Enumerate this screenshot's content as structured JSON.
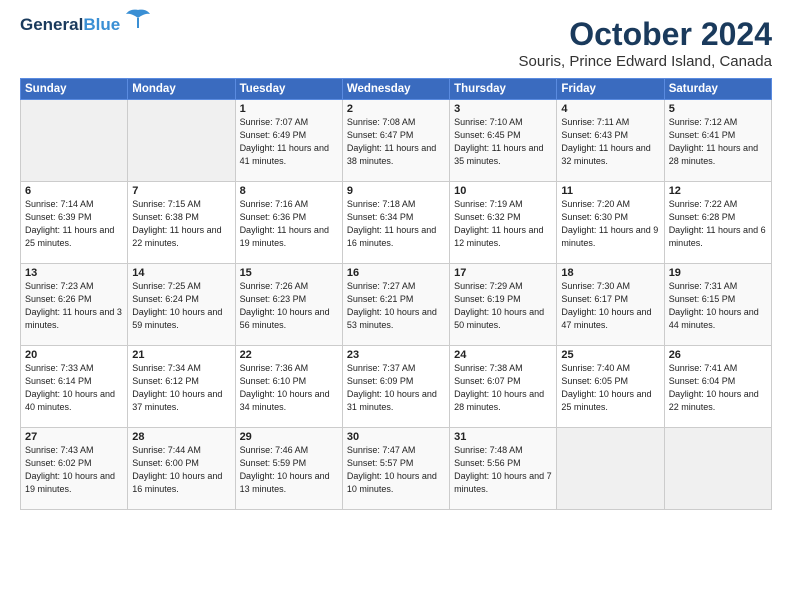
{
  "logo": {
    "line1": "General",
    "line2": "Blue"
  },
  "title": "October 2024",
  "subtitle": "Souris, Prince Edward Island, Canada",
  "weekdays": [
    "Sunday",
    "Monday",
    "Tuesday",
    "Wednesday",
    "Thursday",
    "Friday",
    "Saturday"
  ],
  "weeks": [
    [
      {
        "day": "",
        "sunrise": "",
        "sunset": "",
        "daylight": ""
      },
      {
        "day": "",
        "sunrise": "",
        "sunset": "",
        "daylight": ""
      },
      {
        "day": "1",
        "sunrise": "Sunrise: 7:07 AM",
        "sunset": "Sunset: 6:49 PM",
        "daylight": "Daylight: 11 hours and 41 minutes."
      },
      {
        "day": "2",
        "sunrise": "Sunrise: 7:08 AM",
        "sunset": "Sunset: 6:47 PM",
        "daylight": "Daylight: 11 hours and 38 minutes."
      },
      {
        "day": "3",
        "sunrise": "Sunrise: 7:10 AM",
        "sunset": "Sunset: 6:45 PM",
        "daylight": "Daylight: 11 hours and 35 minutes."
      },
      {
        "day": "4",
        "sunrise": "Sunrise: 7:11 AM",
        "sunset": "Sunset: 6:43 PM",
        "daylight": "Daylight: 11 hours and 32 minutes."
      },
      {
        "day": "5",
        "sunrise": "Sunrise: 7:12 AM",
        "sunset": "Sunset: 6:41 PM",
        "daylight": "Daylight: 11 hours and 28 minutes."
      }
    ],
    [
      {
        "day": "6",
        "sunrise": "Sunrise: 7:14 AM",
        "sunset": "Sunset: 6:39 PM",
        "daylight": "Daylight: 11 hours and 25 minutes."
      },
      {
        "day": "7",
        "sunrise": "Sunrise: 7:15 AM",
        "sunset": "Sunset: 6:38 PM",
        "daylight": "Daylight: 11 hours and 22 minutes."
      },
      {
        "day": "8",
        "sunrise": "Sunrise: 7:16 AM",
        "sunset": "Sunset: 6:36 PM",
        "daylight": "Daylight: 11 hours and 19 minutes."
      },
      {
        "day": "9",
        "sunrise": "Sunrise: 7:18 AM",
        "sunset": "Sunset: 6:34 PM",
        "daylight": "Daylight: 11 hours and 16 minutes."
      },
      {
        "day": "10",
        "sunrise": "Sunrise: 7:19 AM",
        "sunset": "Sunset: 6:32 PM",
        "daylight": "Daylight: 11 hours and 12 minutes."
      },
      {
        "day": "11",
        "sunrise": "Sunrise: 7:20 AM",
        "sunset": "Sunset: 6:30 PM",
        "daylight": "Daylight: 11 hours and 9 minutes."
      },
      {
        "day": "12",
        "sunrise": "Sunrise: 7:22 AM",
        "sunset": "Sunset: 6:28 PM",
        "daylight": "Daylight: 11 hours and 6 minutes."
      }
    ],
    [
      {
        "day": "13",
        "sunrise": "Sunrise: 7:23 AM",
        "sunset": "Sunset: 6:26 PM",
        "daylight": "Daylight: 11 hours and 3 minutes."
      },
      {
        "day": "14",
        "sunrise": "Sunrise: 7:25 AM",
        "sunset": "Sunset: 6:24 PM",
        "daylight": "Daylight: 10 hours and 59 minutes."
      },
      {
        "day": "15",
        "sunrise": "Sunrise: 7:26 AM",
        "sunset": "Sunset: 6:23 PM",
        "daylight": "Daylight: 10 hours and 56 minutes."
      },
      {
        "day": "16",
        "sunrise": "Sunrise: 7:27 AM",
        "sunset": "Sunset: 6:21 PM",
        "daylight": "Daylight: 10 hours and 53 minutes."
      },
      {
        "day": "17",
        "sunrise": "Sunrise: 7:29 AM",
        "sunset": "Sunset: 6:19 PM",
        "daylight": "Daylight: 10 hours and 50 minutes."
      },
      {
        "day": "18",
        "sunrise": "Sunrise: 7:30 AM",
        "sunset": "Sunset: 6:17 PM",
        "daylight": "Daylight: 10 hours and 47 minutes."
      },
      {
        "day": "19",
        "sunrise": "Sunrise: 7:31 AM",
        "sunset": "Sunset: 6:15 PM",
        "daylight": "Daylight: 10 hours and 44 minutes."
      }
    ],
    [
      {
        "day": "20",
        "sunrise": "Sunrise: 7:33 AM",
        "sunset": "Sunset: 6:14 PM",
        "daylight": "Daylight: 10 hours and 40 minutes."
      },
      {
        "day": "21",
        "sunrise": "Sunrise: 7:34 AM",
        "sunset": "Sunset: 6:12 PM",
        "daylight": "Daylight: 10 hours and 37 minutes."
      },
      {
        "day": "22",
        "sunrise": "Sunrise: 7:36 AM",
        "sunset": "Sunset: 6:10 PM",
        "daylight": "Daylight: 10 hours and 34 minutes."
      },
      {
        "day": "23",
        "sunrise": "Sunrise: 7:37 AM",
        "sunset": "Sunset: 6:09 PM",
        "daylight": "Daylight: 10 hours and 31 minutes."
      },
      {
        "day": "24",
        "sunrise": "Sunrise: 7:38 AM",
        "sunset": "Sunset: 6:07 PM",
        "daylight": "Daylight: 10 hours and 28 minutes."
      },
      {
        "day": "25",
        "sunrise": "Sunrise: 7:40 AM",
        "sunset": "Sunset: 6:05 PM",
        "daylight": "Daylight: 10 hours and 25 minutes."
      },
      {
        "day": "26",
        "sunrise": "Sunrise: 7:41 AM",
        "sunset": "Sunset: 6:04 PM",
        "daylight": "Daylight: 10 hours and 22 minutes."
      }
    ],
    [
      {
        "day": "27",
        "sunrise": "Sunrise: 7:43 AM",
        "sunset": "Sunset: 6:02 PM",
        "daylight": "Daylight: 10 hours and 19 minutes."
      },
      {
        "day": "28",
        "sunrise": "Sunrise: 7:44 AM",
        "sunset": "Sunset: 6:00 PM",
        "daylight": "Daylight: 10 hours and 16 minutes."
      },
      {
        "day": "29",
        "sunrise": "Sunrise: 7:46 AM",
        "sunset": "Sunset: 5:59 PM",
        "daylight": "Daylight: 10 hours and 13 minutes."
      },
      {
        "day": "30",
        "sunrise": "Sunrise: 7:47 AM",
        "sunset": "Sunset: 5:57 PM",
        "daylight": "Daylight: 10 hours and 10 minutes."
      },
      {
        "day": "31",
        "sunrise": "Sunrise: 7:48 AM",
        "sunset": "Sunset: 5:56 PM",
        "daylight": "Daylight: 10 hours and 7 minutes."
      },
      {
        "day": "",
        "sunrise": "",
        "sunset": "",
        "daylight": ""
      },
      {
        "day": "",
        "sunrise": "",
        "sunset": "",
        "daylight": ""
      }
    ]
  ]
}
